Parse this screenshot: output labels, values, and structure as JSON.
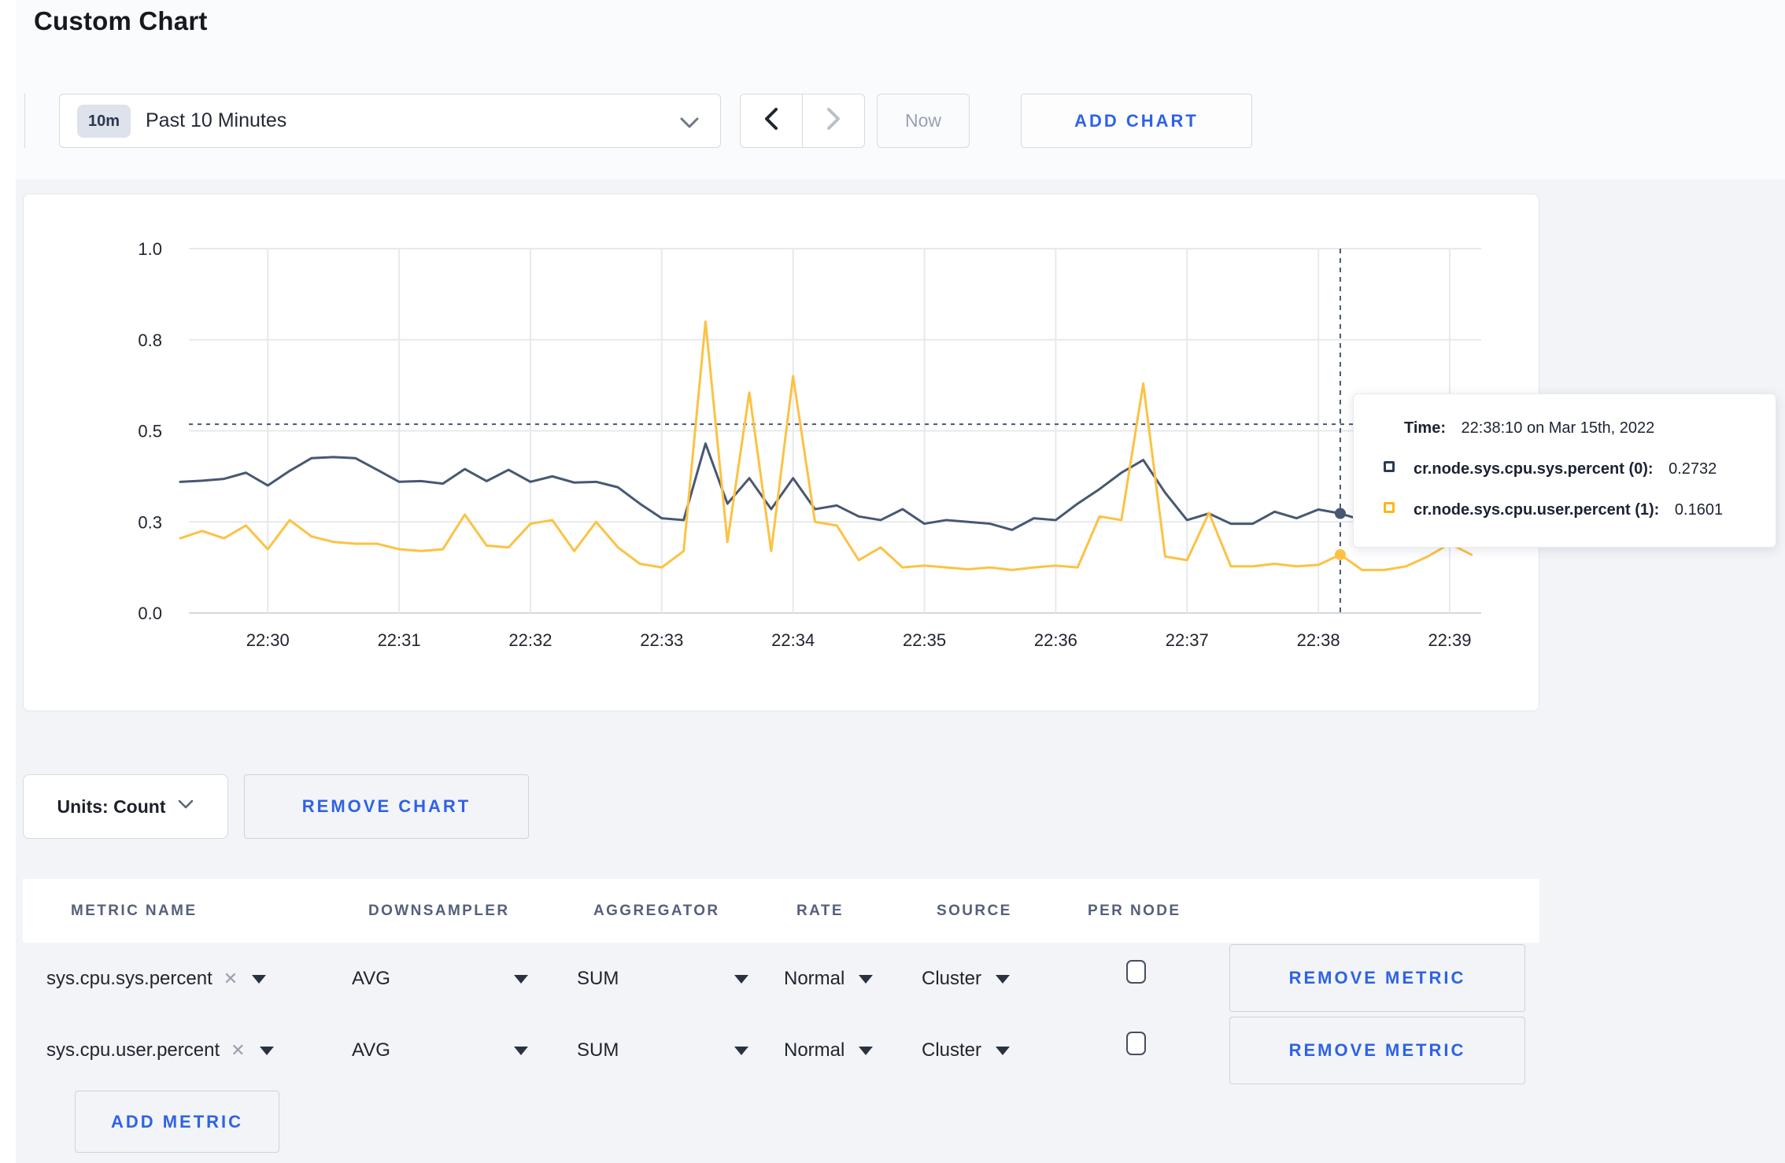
{
  "page": {
    "title": "Custom Chart"
  },
  "colors": {
    "accent_blue": "#2e62e6",
    "page_background": "#f2f4f7",
    "grid_line": "#e7e9ed",
    "axis_line": "#d4d7dc",
    "crosshair": "#475872"
  },
  "toolbar": {
    "timescale_badge": "10m",
    "timescale_label": "Past 10 Minutes",
    "now_label": "Now",
    "add_chart_label": "ADD CHART"
  },
  "chart_data": {
    "type": "line",
    "x_start_time": "22:29:20",
    "x_interval_seconds": 10,
    "x_tick_labels": [
      "22:30",
      "22:31",
      "22:32",
      "22:33",
      "22:34",
      "22:35",
      "22:36",
      "22:37",
      "22:38",
      "22:39"
    ],
    "y_ticks": [
      {
        "value": 0,
        "label": "0.0"
      },
      {
        "value": 0.25,
        "label": "0.3"
      },
      {
        "value": 0.5,
        "label": "0.5"
      },
      {
        "value": 0.75,
        "label": "0.8"
      },
      {
        "value": 1.0,
        "label": "1.0"
      }
    ],
    "ylim": [
      0,
      1
    ],
    "grid": true,
    "legend_position": "tooltip",
    "crosshair": {
      "index": 53,
      "time": "22:38:10",
      "hline_value": 0.518
    },
    "series": [
      {
        "name": "cr.node.sys.cpu.sys.percent",
        "color": "#475872",
        "values": [
          0.36,
          0.363,
          0.368,
          0.385,
          0.35,
          0.39,
          0.425,
          0.428,
          0.425,
          0.393,
          0.36,
          0.362,
          0.355,
          0.395,
          0.362,
          0.393,
          0.36,
          0.375,
          0.358,
          0.36,
          0.345,
          0.3,
          0.26,
          0.255,
          0.465,
          0.3,
          0.37,
          0.285,
          0.37,
          0.285,
          0.295,
          0.265,
          0.255,
          0.285,
          0.245,
          0.255,
          0.25,
          0.245,
          0.228,
          0.26,
          0.255,
          0.3,
          0.34,
          0.385,
          0.42,
          0.33,
          0.255,
          0.273,
          0.245,
          0.245,
          0.278,
          0.26,
          0.284,
          0.2732,
          0.255,
          0.26,
          0.26,
          0.27,
          0.265,
          0.275
        ]
      },
      {
        "name": "cr.node.sys.cpu.user.percent",
        "color": "#fcc243",
        "values": [
          0.205,
          0.225,
          0.205,
          0.24,
          0.175,
          0.255,
          0.21,
          0.195,
          0.19,
          0.19,
          0.175,
          0.17,
          0.175,
          0.27,
          0.185,
          0.18,
          0.245,
          0.255,
          0.17,
          0.25,
          0.18,
          0.135,
          0.125,
          0.17,
          0.8,
          0.195,
          0.605,
          0.17,
          0.65,
          0.25,
          0.24,
          0.145,
          0.18,
          0.125,
          0.13,
          0.125,
          0.12,
          0.125,
          0.118,
          0.125,
          0.13,
          0.125,
          0.265,
          0.255,
          0.63,
          0.155,
          0.145,
          0.275,
          0.128,
          0.128,
          0.135,
          0.128,
          0.132,
          0.1601,
          0.118,
          0.118,
          0.128,
          0.155,
          0.19,
          0.16
        ]
      }
    ]
  },
  "tooltip": {
    "time_label": "Time:",
    "time_value": "22:38:10 on Mar 15th, 2022",
    "rows": [
      {
        "swatch_color": "#2c3a55",
        "label": "cr.node.sys.cpu.sys.percent (0):",
        "value": "0.2732"
      },
      {
        "swatch_color": "#fdb619",
        "label": "cr.node.sys.cpu.user.percent (1):",
        "value": "0.1601"
      }
    ]
  },
  "chart_footer": {
    "units_label": "Units: Count",
    "remove_chart_label": "REMOVE CHART"
  },
  "table": {
    "columns": [
      "METRIC NAME",
      "DOWNSAMPLER",
      "AGGREGATOR",
      "RATE",
      "SOURCE",
      "PER NODE"
    ],
    "rows": [
      {
        "metric": "sys.cpu.sys.percent",
        "downsampler": "AVG",
        "aggregator": "SUM",
        "rate": "Normal",
        "source": "Cluster",
        "per_node_checked": false
      },
      {
        "metric": "sys.cpu.user.percent",
        "downsampler": "AVG",
        "aggregator": "SUM",
        "rate": "Normal",
        "source": "Cluster",
        "per_node_checked": false
      }
    ],
    "remove_metric_label": "REMOVE METRIC",
    "add_metric_label": "ADD METRIC"
  }
}
